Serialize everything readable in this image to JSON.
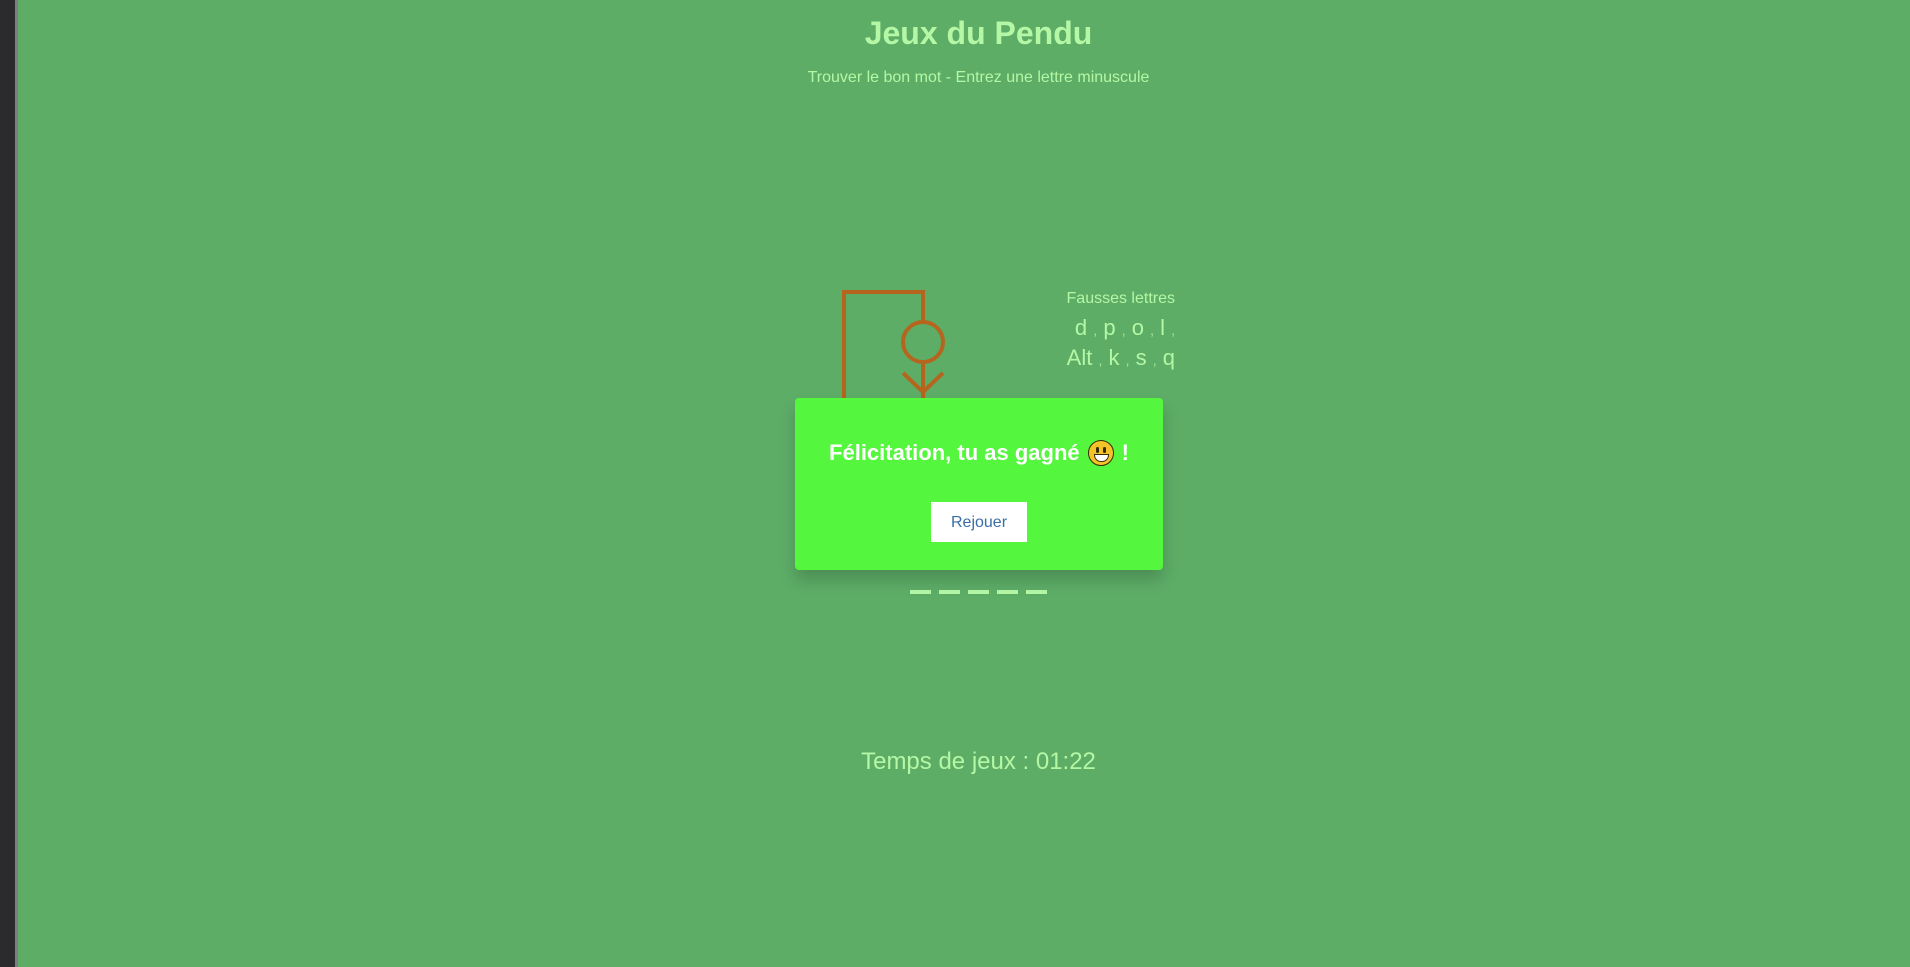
{
  "game": {
    "title": "Jeux du Pendu",
    "subtitle": "Trouver le bon mot - Entrez une lettre minuscule"
  },
  "wrong_letters": {
    "label": "Fausses lettres",
    "line1": [
      {
        "l": "d",
        "s": ","
      },
      {
        "l": "p",
        "s": ","
      },
      {
        "l": "o",
        "s": ","
      },
      {
        "l": "l",
        "s": ","
      }
    ],
    "line2": [
      {
        "l": "Alt",
        "s": ","
      },
      {
        "l": "k",
        "s": ","
      },
      {
        "l": "s",
        "s": ","
      },
      {
        "l": "q",
        "s": ""
      }
    ],
    "count": 8
  },
  "word": {
    "letters": [
      "",
      "",
      "",
      "",
      ""
    ]
  },
  "timer": {
    "text": "Temps de jeux : 01:22"
  },
  "popup": {
    "message": "Félicitation, tu as gagné",
    "emoji": "grinning-face-icon",
    "suffix": "!",
    "button_label": "Rejouer"
  },
  "colors": {
    "background": "#5dad67",
    "text": "#b4f7a5",
    "gallows": "#b5651d",
    "popup": "#55f73e",
    "button_text": "#3b6ea8"
  }
}
